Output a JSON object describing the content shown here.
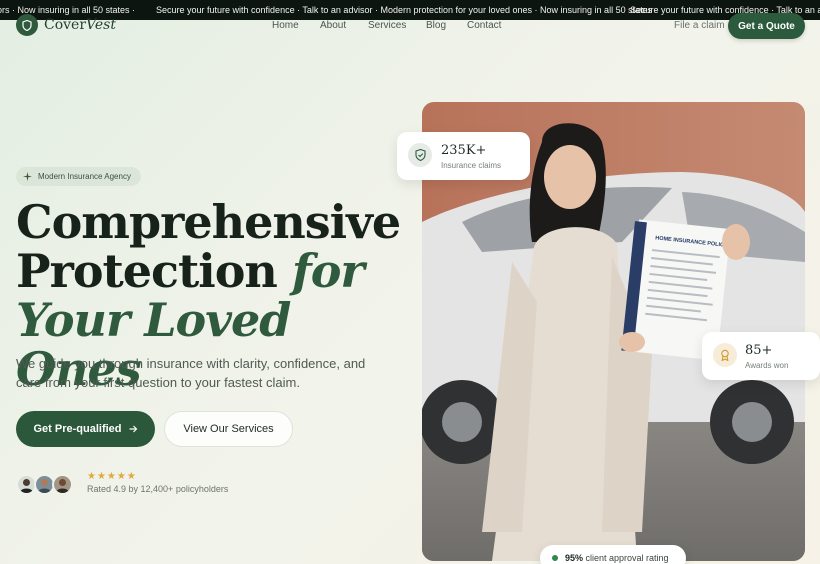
{
  "marquee": {
    "segment_a": "ors · Now insuring in all 50 states ·",
    "segment_b": "Secure your future with confidence · Talk to an advisor · Modern protection for your loved ones · Now insuring in all 50 states ·",
    "segment_c": "Secure your future with confidence · Talk to an advisor"
  },
  "brand": {
    "name_regular": "Cover",
    "name_italic": "Vest"
  },
  "nav": {
    "links": [
      "Home",
      "About",
      "Services",
      "Blog",
      "Contact"
    ],
    "claim": "File a claim",
    "cta": "Get a Quote"
  },
  "hero": {
    "tag": "Modern Insurance Agency",
    "headline_line1": "Comprehensive",
    "headline_line2": "Protection ",
    "headline_accent1": "for",
    "headline_accent2": "Your Loved Ones",
    "subheadline": "We guide you through insurance with clarity, confidence, and care from your first question to your fastest claim.",
    "primary_button": "Get Pre-qualified",
    "secondary_button": "View Our Services",
    "stars": "★★★★★",
    "rating_text": "Rated 4.9 by 12,400+ policyholders",
    "document_title": "HOME INSURANCE POLICY"
  },
  "stats": {
    "claims_value": "235K+",
    "claims_label": "Insurance claims",
    "awards_value": "85+",
    "awards_label": "Awards won",
    "approval_value": "95%",
    "approval_label": " client approval rating"
  },
  "colors": {
    "brand_green": "#2c5a3c",
    "star_gold": "#e2a93b",
    "marquee_bg": "#0d1510"
  }
}
